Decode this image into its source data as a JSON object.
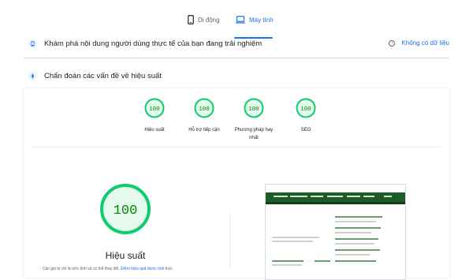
{
  "tabs": [
    {
      "label": "Di động",
      "icon": "phone-icon",
      "selected": false
    },
    {
      "label": "Máy tính",
      "icon": "laptop-icon",
      "selected": true
    }
  ],
  "field_data": {
    "title": "Khám phá nội dung người dùng thực tế của bạn đang trải nghiệm",
    "no_data_label": "Không có dữ liệu"
  },
  "diagnostics": {
    "title": "Chẩn đoán các vấn đề về hiệu suất"
  },
  "scores": [
    {
      "value": "100",
      "label": "Hiệu suất"
    },
    {
      "value": "100",
      "label": "Hỗ trợ tiếp cận"
    },
    {
      "value": "100",
      "label": "Phương pháp hay nhất"
    },
    {
      "value": "100",
      "label": "SEO"
    }
  ],
  "main_score": {
    "value": "100",
    "label": "Hiệu suất",
    "note_prefix": "Các giá trị chỉ là ước tính và có thể thay đổi.",
    "note_link": "Điểm hiệu quả được tính",
    "note_suffix": "trực"
  },
  "colors": {
    "pass": "#0cce6b",
    "pass_bg": "#e6f9ee",
    "pass_text": "#008800",
    "accent": "#1a73e8"
  }
}
